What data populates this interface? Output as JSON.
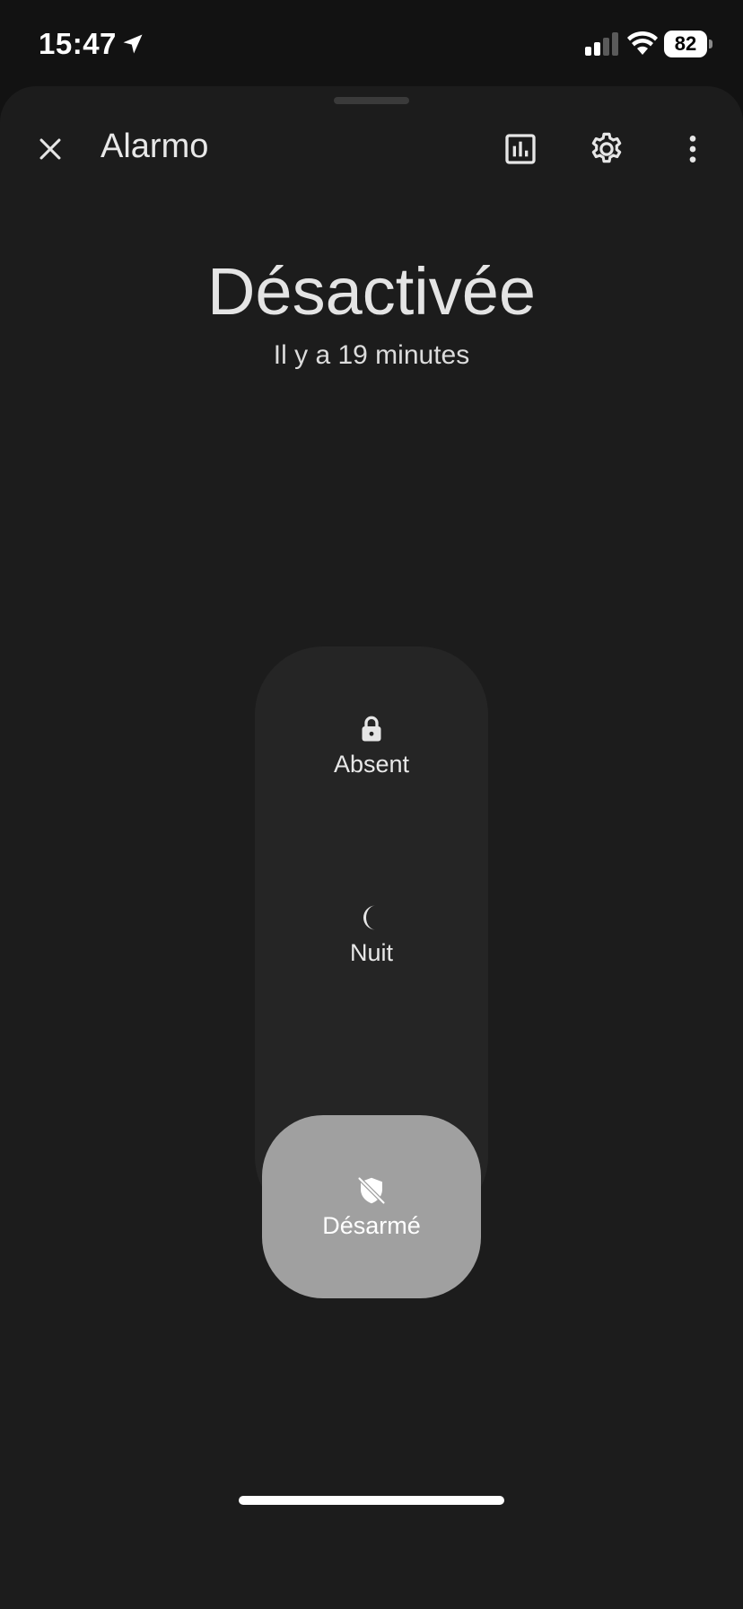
{
  "status_bar": {
    "time": "15:47",
    "battery_level": "82"
  },
  "header": {
    "title": "Alarmo",
    "icons": [
      "close-icon",
      "history-icon",
      "gear-icon",
      "more-vertical-icon"
    ]
  },
  "alarm": {
    "state": "Désactivée",
    "since": "Il y a 19 minutes"
  },
  "modes": [
    {
      "label": "Absent",
      "icon": "lock-icon",
      "selected": false
    },
    {
      "label": "Nuit",
      "icon": "moon-icon",
      "selected": false
    },
    {
      "label": "Désarmé",
      "icon": "shield-off-icon",
      "selected": true
    }
  ],
  "colors": {
    "background": "#1c1c1c",
    "panel": "#252525",
    "selected_mode": "#a0a0a0"
  }
}
